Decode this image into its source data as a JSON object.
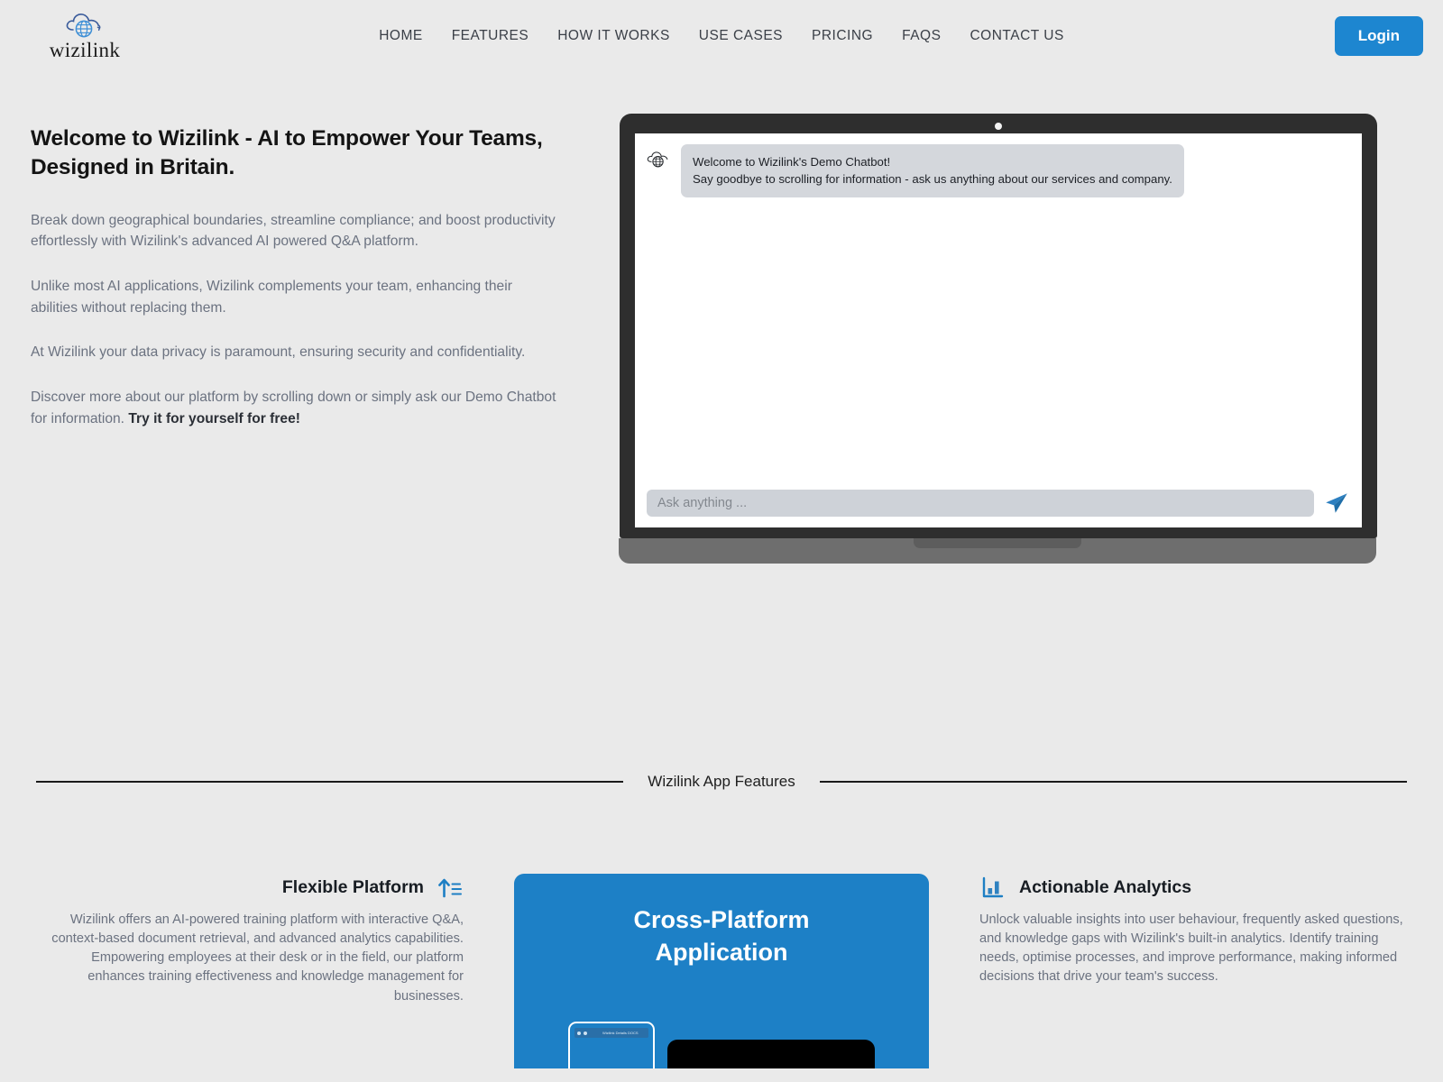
{
  "brand": {
    "name": "wizilink",
    "logo_icon": "cloud-globe-icon"
  },
  "nav": {
    "items": [
      {
        "label": "HOME"
      },
      {
        "label": "FEATURES"
      },
      {
        "label": "HOW IT WORKS"
      },
      {
        "label": "USE CASES"
      },
      {
        "label": "PRICING"
      },
      {
        "label": "FAQS"
      },
      {
        "label": "CONTACT US"
      }
    ],
    "login_label": "Login",
    "login_color": "#1d86d0"
  },
  "hero": {
    "title": "Welcome to Wizilink - AI to Empower Your Teams, Designed in Britain.",
    "paragraphs": [
      "Break down geographical boundaries, streamline compliance; and boost productivity effortlessly with Wizilink's advanced AI powered Q&A platform.",
      "Unlike most AI applications, Wizilink complements your team, enhancing their abilities without replacing them.",
      "At Wizilink your data privacy is paramount, ensuring security and confidentiality."
    ],
    "last_paragraph_prefix": "Discover more about our platform by scrolling down or simply ask our Demo Chatbot for information. ",
    "last_paragraph_bold": "Try it for yourself for free!"
  },
  "chatbot": {
    "avatar_icon": "cloud-globe-icon",
    "message_line1": "Welcome to Wizilink's Demo Chatbot!",
    "message_line2": "Say goodbye to scrolling for information - ask us anything about our services and company.",
    "input_placeholder": "Ask anything ...",
    "input_value": "",
    "send_icon": "paper-plane-icon"
  },
  "section": {
    "divider_label": "Wizilink App Features"
  },
  "features": {
    "left": {
      "title": "Flexible Platform",
      "icon": "sort-ascending-icon",
      "body": "Wizilink offers an AI-powered training platform with interactive Q&A, context-based document retrieval, and advanced analytics capabilities. Empowering employees at their desk or in the field, our platform enhances training effectiveness and knowledge management for businesses."
    },
    "right": {
      "title": "Actionable Analytics",
      "icon": "bar-chart-icon",
      "body": "Unlock valuable insights into user behaviour, frequently asked questions, and knowledge gaps with Wizilink's built-in analytics. Identify training needs, optimise processes, and improve performance, making informed decisions that drive your team's success."
    },
    "card": {
      "title_line1": "Cross-Platform",
      "title_line2": "Application",
      "color": "#1d80c6",
      "tablet_label": "Wizilink Details DOCS"
    }
  }
}
